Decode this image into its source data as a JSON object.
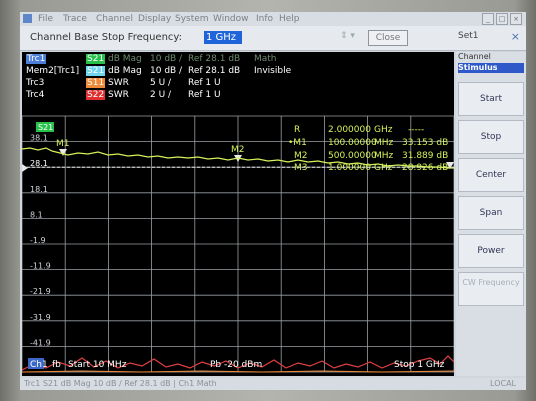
{
  "menu": {
    "items": [
      "File",
      "Trace",
      "Channel",
      "Display",
      "System",
      "Window",
      "Info",
      "Help"
    ],
    "window_buttons": [
      "_",
      "□",
      "×"
    ]
  },
  "toolbar": {
    "label": "Channel Base Stop Frequency:",
    "value": "1 GHz",
    "close_label": "Close",
    "setup_label": "Set1",
    "close_x": "×"
  },
  "traces": [
    {
      "name": "Trc1",
      "meas": "S21",
      "format": "dB Mag",
      "scale": "10 dB /",
      "ref": "Ref 28.1 dB",
      "extra": "Math",
      "active": true
    },
    {
      "name": "Mem2[Trc1]",
      "meas": "S21",
      "format": "dB Mag",
      "scale": "10 dB /",
      "ref": "Ref 28.1 dB",
      "extra": "Invisible",
      "active": false
    },
    {
      "name": "Trc3",
      "meas": "S11",
      "format": "SWR",
      "scale": "5 U /",
      "ref": "Ref 1 U",
      "extra": "",
      "active": false
    },
    {
      "name": "Trc4",
      "meas": "S22",
      "format": "SWR",
      "scale": "2 U /",
      "ref": "Ref 1 U",
      "extra": "",
      "active": false
    }
  ],
  "plot": {
    "trace_tag": "S21",
    "reference_value": "28.1",
    "y_labels": [
      "38.1",
      "28.1",
      "18.1",
      "8.1",
      "-1.9",
      "-11.9",
      "-21.9",
      "-31.9",
      "-41.9"
    ],
    "marker_table": {
      "header": {
        "name": "R",
        "freq": "2.000000",
        "unit": "GHz",
        "value": "-----"
      },
      "rows": [
        {
          "name": "•M1",
          "freq": "100.00000",
          "unit": "MHz",
          "value": "33.153 dB"
        },
        {
          "name": "M2",
          "freq": "500.00000",
          "unit": "MHz",
          "value": "31.889 dB"
        },
        {
          "name": "M3",
          "freq": "1.000000",
          "unit": "GHz",
          "value": "28.926 dB"
        }
      ]
    },
    "markers": [
      "M1",
      "M2",
      "M3"
    ],
    "colors": {
      "trace": "#d4f25a",
      "grid": "#9aa0a6",
      "marker_line": "#e8e8e8",
      "red_trace": "#e34040"
    }
  },
  "footer": {
    "channel": "Ch1",
    "fb": "fb",
    "start": "Start  10 MHz",
    "power": "Pb  -20 dBm",
    "stop": "Stop  1 GHz"
  },
  "statusbar": {
    "left": "Trc1   S21   dB Mag  10 dB / Ref 28.1 dB | Ch1  Math",
    "right": "LOCAL"
  },
  "softkeys": {
    "menu_title": "Channel",
    "menu_sub": "Stimulus",
    "buttons": [
      {
        "label": "Start",
        "enabled": true
      },
      {
        "label": "Stop",
        "enabled": true
      },
      {
        "label": "Center",
        "enabled": true
      },
      {
        "label": "Span",
        "enabled": true
      },
      {
        "label": "Power",
        "enabled": true
      },
      {
        "label": "CW Frequency",
        "enabled": false
      }
    ]
  }
}
